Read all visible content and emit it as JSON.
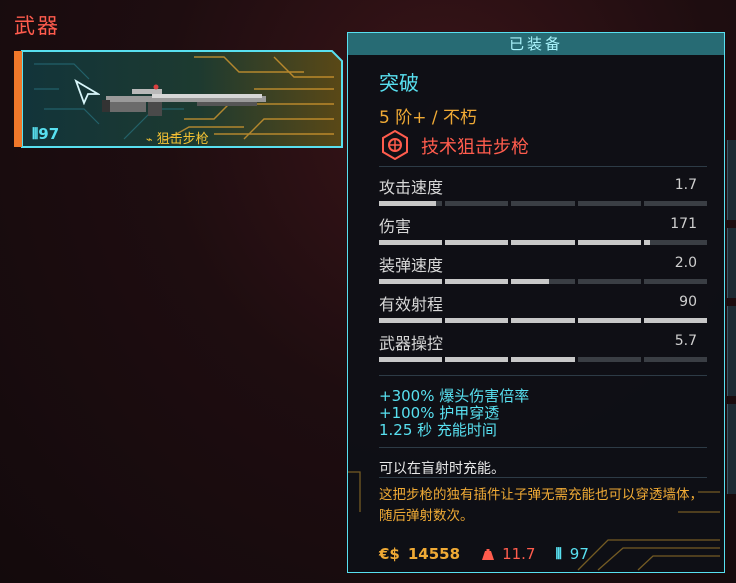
{
  "page": {
    "title": "武器"
  },
  "weapon_slot": {
    "ammo_label": "⫴97",
    "type_icon": "sniper-scope-icon",
    "type_label": "狙击步枪",
    "accent_color": "#f3c234",
    "frame_color": "#58e0f0"
  },
  "tooltip": {
    "header": "已装备",
    "name": "突破",
    "tier": "5 阶+ / 不朽",
    "class_icon": "tech-weapon-icon",
    "class_label": "技术狙击步枪",
    "stats": [
      {
        "label": "攻击速度",
        "value": "1.7",
        "fill": 0.18
      },
      {
        "label": "伤害",
        "value": "171",
        "fill": 0.82
      },
      {
        "label": "装弹速度",
        "value": "2.0",
        "fill": 0.52
      },
      {
        "label": "有效射程",
        "value": "90",
        "fill": 1.0
      },
      {
        "label": "武器操控",
        "value": "5.7",
        "fill": 0.6
      }
    ],
    "bonuses": [
      "+300% 爆头伤害倍率",
      "+100% 护甲穿透",
      "1.25 秒 充能时间"
    ],
    "effect": "可以在盲射时充能。",
    "description": "这把步枪的独有插件让子弹无需充能也可以穿透墙体，随后弹射数次。",
    "footer": {
      "money_icon": "€$",
      "price": "14558",
      "weight_icon": "weight-icon",
      "weight": "11.7",
      "ammo_icon": "⫴",
      "ammo": "97"
    },
    "colors": {
      "cyan": "#58e0f0",
      "orange": "#f0aa35",
      "red": "#ff5c4d"
    }
  }
}
